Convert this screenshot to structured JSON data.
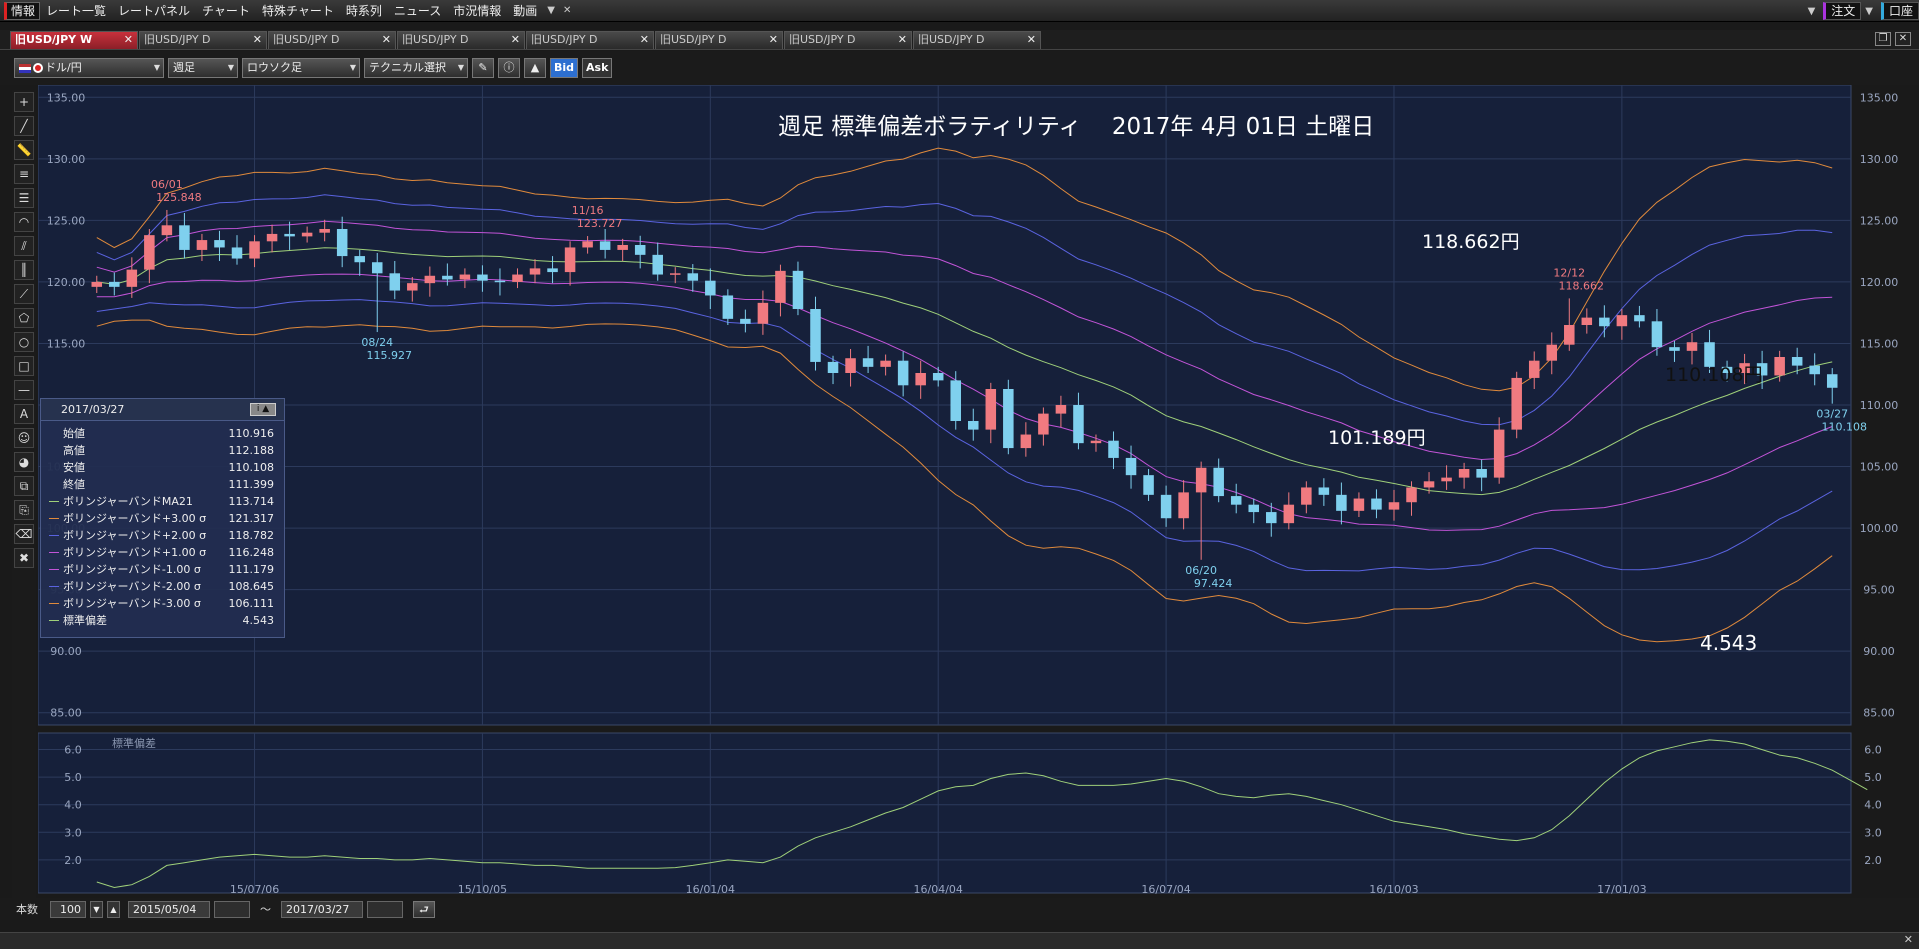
{
  "menubar": {
    "items": [
      "情報",
      "レート一覧",
      "レートパネル",
      "チャート",
      "特殊チャート",
      "時系列",
      "ニュース",
      "市況情報",
      "動画"
    ],
    "right": {
      "order": "注文",
      "account": "口座"
    }
  },
  "tabs": [
    {
      "label": "旧USD/JPY W",
      "active": true
    },
    {
      "label": "旧USD/JPY D"
    },
    {
      "label": "旧USD/JPY D"
    },
    {
      "label": "旧USD/JPY D"
    },
    {
      "label": "旧USD/JPY D"
    },
    {
      "label": "旧USD/JPY D"
    },
    {
      "label": "旧USD/JPY D"
    },
    {
      "label": "旧USD/JPY D"
    }
  ],
  "toolbar": {
    "pair": "ドル/円",
    "period": "週足",
    "chart_type": "ロウソク足",
    "technical": "テクニカル選択",
    "bid": "Bid",
    "ask": "Ask"
  },
  "overlay": {
    "title": "週足 標準偏差ボラティリティ　 2017年 4月 01日 土曜日",
    "high_callout": "118.662円",
    "low_callout": "101.189円",
    "last_callout": "110.108円",
    "sd_callout": "4.543"
  },
  "info": {
    "date": "2017/03/27",
    "rows": [
      {
        "label": "始値",
        "value": "110.916",
        "color": ""
      },
      {
        "label": "高値",
        "value": "112.188",
        "color": ""
      },
      {
        "label": "安値",
        "value": "110.108",
        "color": ""
      },
      {
        "label": "終値",
        "value": "111.399",
        "color": ""
      },
      {
        "label": "ボリンジャーバンドMA21",
        "value": "113.714",
        "color": "#9fd07a"
      },
      {
        "label": "ボリンジャーバンド+3.00 σ",
        "value": "121.317",
        "color": "#e08a3c"
      },
      {
        "label": "ボリンジャーバンド+2.00 σ",
        "value": "118.782",
        "color": "#5a63e0"
      },
      {
        "label": "ボリンジャーバンド+1.00 σ",
        "value": "116.248",
        "color": "#c254d8"
      },
      {
        "label": "ボリンジャーバンド-1.00 σ",
        "value": "111.179",
        "color": "#c254d8"
      },
      {
        "label": "ボリンジャーバンド-2.00 σ",
        "value": "108.645",
        "color": "#5a63e0"
      },
      {
        "label": "ボリンジャーバンド-3.00 σ",
        "value": "106.111",
        "color": "#e08a3c"
      },
      {
        "label": "標準偏差",
        "value": "4.543",
        "color": "#9fd07a"
      }
    ]
  },
  "bottombar": {
    "count_label": "本数",
    "count": "100",
    "from": "2015/05/04",
    "tilde": "～",
    "to": "2017/03/27"
  },
  "chart_data": {
    "type": "candlestick",
    "colors": {
      "up": "#f07a80",
      "down": "#7fd0ee",
      "ma": "#9fd07a",
      "s3": "#e08a3c",
      "s2": "#5a63e0",
      "s1": "#c254d8",
      "sd": "#9fd07a"
    },
    "main_axis": {
      "ylim": [
        84,
        136
      ],
      "ticks": [
        "135.00",
        "130.00",
        "125.00",
        "120.00",
        "115.00",
        "110.00",
        "105.00",
        "100.00",
        "95.00",
        "90.00",
        "85.00"
      ],
      "tick_values": [
        135,
        130,
        125,
        120,
        115,
        110,
        105,
        100,
        95,
        90,
        85
      ]
    },
    "sub_axis": {
      "label": "標準偏差",
      "ylim": [
        0.8,
        6.6
      ],
      "ticks": [
        "6.0",
        "5.0",
        "4.0",
        "3.0",
        "2.0"
      ],
      "tick_values": [
        6,
        5,
        4,
        3,
        2
      ]
    },
    "x_ticks": [
      {
        "label": "15/07/06",
        "index": 9
      },
      {
        "label": "15/10/05",
        "index": 22
      },
      {
        "label": "16/01/04",
        "index": 35
      },
      {
        "label": "16/04/04",
        "index": 48
      },
      {
        "label": "16/07/04",
        "index": 61
      },
      {
        "label": "16/10/03",
        "index": 74
      },
      {
        "label": "17/01/03",
        "index": 87
      }
    ],
    "annotations": [
      {
        "date": "06/01",
        "value": "125.848",
        "index": 4,
        "price": 125.848,
        "pos": "above",
        "color": "#f07a80"
      },
      {
        "date": "08/24",
        "value": "115.927",
        "index": 16,
        "price": 115.927,
        "pos": "below",
        "color": "#7fd0ee"
      },
      {
        "date": "11/16",
        "value": "123.727",
        "index": 28,
        "price": 123.727,
        "pos": "above",
        "color": "#f07a80"
      },
      {
        "date": "06/20",
        "value": "97.424",
        "index": 63,
        "price": 97.424,
        "pos": "below",
        "color": "#7fd0ee"
      },
      {
        "date": "12/12",
        "value": "118.662",
        "index": 84,
        "price": 118.662,
        "pos": "above",
        "color": "#f07a80"
      },
      {
        "date": "03/27",
        "value": "110.108",
        "index": 99,
        "price": 110.108,
        "pos": "below",
        "color": "#7fd0ee"
      }
    ],
    "closes": [
      120.0,
      119.6,
      121.0,
      123.8,
      124.6,
      122.6,
      123.4,
      122.8,
      121.9,
      123.3,
      123.9,
      123.7,
      124.0,
      124.3,
      122.1,
      121.6,
      120.7,
      119.3,
      119.9,
      120.5,
      120.2,
      120.6,
      120.1,
      120.0,
      120.6,
      121.1,
      120.8,
      122.8,
      123.3,
      122.6,
      123.0,
      122.2,
      120.6,
      120.7,
      120.1,
      118.9,
      117.0,
      116.6,
      118.3,
      120.9,
      117.8,
      113.5,
      112.6,
      113.8,
      113.1,
      113.6,
      111.6,
      112.6,
      112.0,
      108.7,
      108.0,
      111.3,
      106.5,
      107.6,
      109.3,
      110.0,
      106.9,
      107.1,
      105.7,
      104.3,
      102.7,
      100.8,
      102.9,
      104.9,
      102.6,
      101.9,
      101.3,
      100.4,
      101.9,
      103.3,
      102.7,
      101.4,
      102.4,
      101.5,
      102.1,
      103.3,
      103.8,
      104.1,
      104.8,
      104.1,
      108.0,
      112.2,
      113.6,
      114.9,
      116.5,
      117.1,
      116.4,
      117.3,
      116.8,
      114.7,
      114.4,
      115.1,
      113.1,
      112.6,
      113.4,
      112.4,
      113.9,
      113.2,
      112.5,
      111.4
    ],
    "sd": [
      1.2,
      1.0,
      1.1,
      1.4,
      1.8,
      1.9,
      2.0,
      2.1,
      2.15,
      2.2,
      2.15,
      2.1,
      2.1,
      2.15,
      2.1,
      2.05,
      2.05,
      2.0,
      2.0,
      2.05,
      2.0,
      1.95,
      1.9,
      1.9,
      1.85,
      1.8,
      1.8,
      1.75,
      1.7,
      1.7,
      1.7,
      1.7,
      1.7,
      1.72,
      1.8,
      1.9,
      2.0,
      1.95,
      1.9,
      2.1,
      2.5,
      2.8,
      3.0,
      3.2,
      3.45,
      3.7,
      3.9,
      4.2,
      4.5,
      4.65,
      4.7,
      4.95,
      5.1,
      5.15,
      5.05,
      4.85,
      4.7,
      4.7,
      4.7,
      4.75,
      4.85,
      4.95,
      4.85,
      4.65,
      4.4,
      4.3,
      4.25,
      4.35,
      4.4,
      4.3,
      4.15,
      4.0,
      3.8,
      3.6,
      3.4,
      3.3,
      3.2,
      3.1,
      2.95,
      2.85,
      2.75,
      2.7,
      2.8,
      3.1,
      3.6,
      4.2,
      4.8,
      5.3,
      5.7,
      5.95,
      6.1,
      6.25,
      6.35,
      6.3,
      6.2,
      6.0,
      5.8,
      5.7,
      5.5,
      5.25,
      4.9,
      4.543
    ]
  }
}
